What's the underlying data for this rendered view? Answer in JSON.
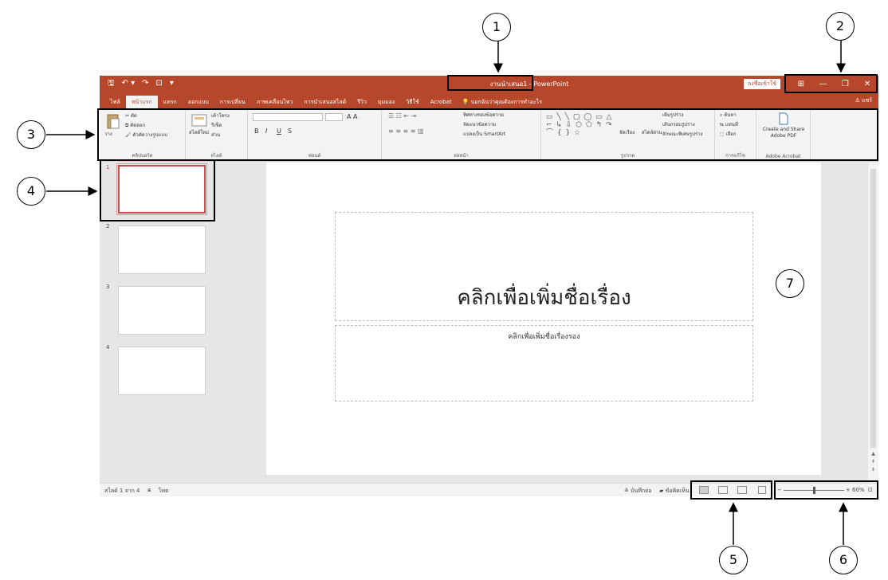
{
  "titlebar": {
    "qat": [
      "🖫",
      "↶ ▾",
      "↷",
      "⊡",
      "▾"
    ],
    "doc_title": "งานนำเสนอ1 - PowerPoint",
    "signin": "ลงชื่อเข้าใช้",
    "controls": [
      "⊞",
      "—",
      "❐",
      "✕"
    ]
  },
  "tabs": [
    "ไฟล์",
    "หน้าแรก",
    "แทรก",
    "ออกแบบ",
    "การเปลี่ยน",
    "ภาพเคลื่อนไหว",
    "การนำเสนอสไลด์",
    "รีวิว",
    "มุมมอง",
    "วิธีใช้",
    "Acrobat"
  ],
  "active_tab": "หน้าแรก",
  "tell_me": "บอกฉันว่าคุณต้องการทำอะไร",
  "share": "แชร์",
  "ribbon": {
    "clipboard": {
      "label": "คลิปบอร์ด",
      "paste": "วาง",
      "cut": "ตัด",
      "copy": "คัดลอก",
      "format_painter": "ตัวคัดวางรูปแบบ"
    },
    "slides": {
      "label": "สไลด์",
      "new_slide": "สไลด์ใหม่",
      "layout": "เค้าโครง",
      "reset": "รีเซ็ต",
      "section": "ส่วน"
    },
    "font": {
      "label": "ฟอนต์",
      "bold": "B",
      "italic": "I",
      "underline": "U",
      "strike": "S",
      "grow": "A A"
    },
    "paragraph": {
      "label": "ย่อหน้า",
      "text_direction": "ทิศทางของข้อความ",
      "align_text": "จัดแนวข้อความ",
      "smartart": "แปลงเป็น SmartArt"
    },
    "drawing": {
      "label": "รูปวาด",
      "shapes": "▭ ╲ ╲ ▢ ◯ ▭ △ ⌐ ↳ ⇩ ⬡ ⬠ ↰ ↷ ⌒ { } ☆",
      "arrange": "จัดเรียง",
      "quick_styles": "สไตล์ด่วน",
      "fill": "เติมรูปร่าง",
      "outline": "เส้นกรอบรูปร่าง",
      "effects": "ลักษณะพิเศษรูปร่าง"
    },
    "editing": {
      "label": "การแก้ไข",
      "find": "ค้นหา",
      "replace": "แทนที่",
      "select": "เลือก"
    },
    "adobe": {
      "label": "Adobe Acrobat",
      "button": "Create and Share Adobe PDF"
    }
  },
  "slides": [
    {
      "number": "1",
      "selected": true
    },
    {
      "number": "2",
      "selected": false
    },
    {
      "number": "3",
      "selected": false
    },
    {
      "number": "4",
      "selected": false
    }
  ],
  "slide_canvas": {
    "title_placeholder": "คลิกเพื่อเพิ่มชื่อเรื่อง",
    "subtitle_placeholder": "คลิกเพื่อเพิ่มชื่อเรื่องรอง"
  },
  "statusbar": {
    "slide_info": "สไลด์ 1 จาก 4",
    "language": "ไทย",
    "notes": "บันทึกย่อ",
    "comments": "ข้อคิดเห็น",
    "zoom": "60%"
  },
  "callouts": [
    "1",
    "2",
    "3",
    "4",
    "5",
    "6",
    "7"
  ],
  "colors": {
    "accent": "#b7472a",
    "selected_thumb": "#c0504d",
    "background": "#e6e6e6"
  }
}
